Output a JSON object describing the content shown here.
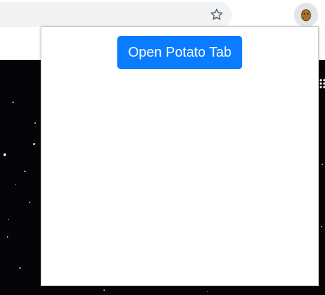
{
  "browser": {
    "toolbar": {
      "bookmark_icon": "star-outline-icon",
      "extension_icon": "potato-icon"
    }
  },
  "popup": {
    "open_button_label": "Open Potato Tab"
  },
  "colors": {
    "button_background": "#0a7cff",
    "button_text": "#ffffff",
    "omnibox_background": "#f1f3f4",
    "page_background": "#050507"
  }
}
